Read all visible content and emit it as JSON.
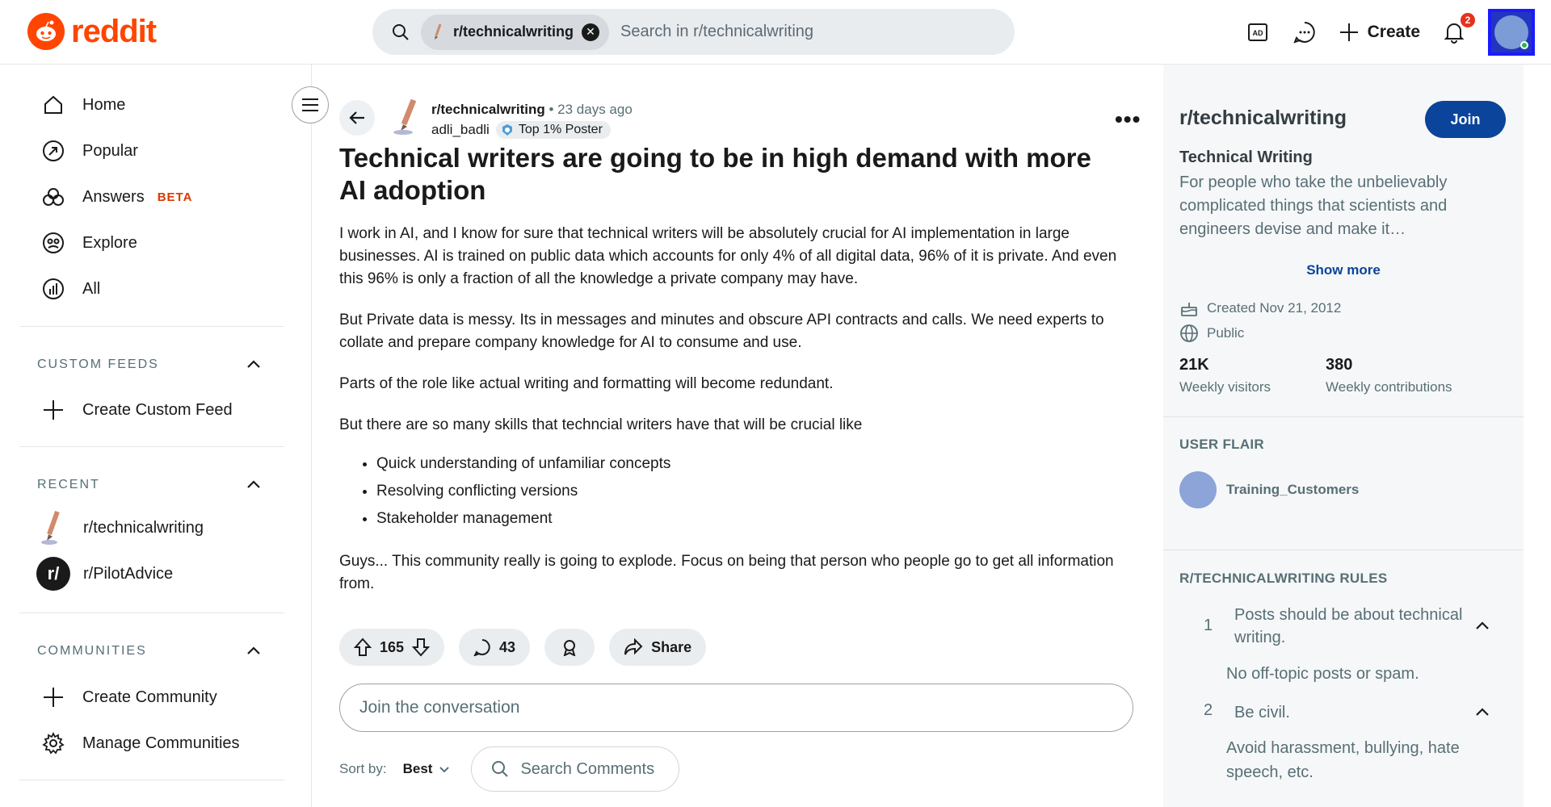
{
  "header": {
    "logo_text": "reddit",
    "search_chip": "r/technicalwriting",
    "search_placeholder": "Search in r/technicalwriting",
    "create_label": "Create",
    "notification_count": "2"
  },
  "sidebar": {
    "nav": [
      {
        "label": "Home",
        "icon": "home-icon"
      },
      {
        "label": "Popular",
        "icon": "popular-icon"
      },
      {
        "label": "Answers",
        "icon": "answers-icon",
        "badge": "BETA"
      },
      {
        "label": "Explore",
        "icon": "explore-icon"
      },
      {
        "label": "All",
        "icon": "all-icon"
      }
    ],
    "custom_feeds": {
      "title": "CUSTOM FEEDS",
      "create": "Create Custom Feed"
    },
    "recent": {
      "title": "RECENT",
      "items": [
        "r/technicalwriting",
        "r/PilotAdvice"
      ]
    },
    "communities": {
      "title": "COMMUNITIES",
      "create": "Create Community",
      "manage": "Manage Communities"
    }
  },
  "post": {
    "subreddit": "r/technicalwriting",
    "time": "• 23 days ago",
    "author": "adli_badli",
    "author_flair": "Top 1% Poster",
    "title": "Technical writers are going to be in high demand with more AI adoption",
    "paragraphs": [
      "I work in AI, and I know for sure that technical writers will be absolutely crucial for AI implementation in large businesses. AI is trained on public data which accounts for only 4% of all digital data, 96% of it is private. And even this 96% is only a fraction of all the knowledge a private company may have.",
      "But Private data is messy. Its in messages and minutes and obscure API contracts and calls. We need experts to collate and prepare company knowledge for AI to consume and use.",
      "Parts of the role like actual writing and formatting will become redundant.",
      "But there are so many skills that techncial writers have that will be crucial like"
    ],
    "bullets": [
      "Quick understanding of unfamiliar concepts",
      "Resolving conflicting versions",
      "Stakeholder management"
    ],
    "closing": "Guys... This community really is going to explode. Focus on being that person who people go to get all information from.",
    "votes": "165",
    "comments": "43",
    "share_label": "Share",
    "join_conversation": "Join the conversation",
    "sort_label": "Sort by:",
    "sort_value": "Best",
    "search_comments": "Search Comments"
  },
  "community": {
    "name": "r/technicalwriting",
    "join_label": "Join",
    "title": "Technical Writing",
    "description": "For people who take the unbelievably complicated things that scientists and engineers devise and make it…",
    "show_more": "Show more",
    "created": "Created Nov 21, 2012",
    "visibility": "Public",
    "weekly_visitors_value": "21K",
    "weekly_visitors_label": "Weekly visitors",
    "weekly_contrib_value": "380",
    "weekly_contrib_label": "Weekly contributions",
    "user_flair_title": "USER FLAIR",
    "user_flair_name": "Training_Customers",
    "rules_title": "R/TECHNICALWRITING RULES",
    "rules": [
      {
        "num": "1",
        "title": "Posts should be about technical writing.",
        "desc": "No off-topic posts or spam."
      },
      {
        "num": "2",
        "title": "Be civil.",
        "desc": "Avoid harassment, bullying, hate speech, etc."
      }
    ]
  },
  "colors": {
    "brand": "#ff4500",
    "join": "#0a449b",
    "beta": "#d93a00"
  }
}
